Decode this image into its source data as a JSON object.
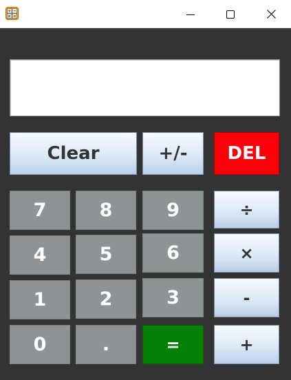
{
  "window": {
    "title_icon": "calculator-app-icon",
    "controls": {
      "minimize_icon": "minimize-icon",
      "maximize_icon": "maximize-icon",
      "close_icon": "close-icon"
    }
  },
  "display": {
    "value": ""
  },
  "top_row": {
    "clear": "Clear",
    "sign": "+/-",
    "del": "DEL"
  },
  "digits": {
    "seven": "7",
    "eight": "8",
    "nine": "9",
    "four": "4",
    "five": "5",
    "six": "6",
    "one": "1",
    "two": "2",
    "three": "3",
    "zero": "0",
    "dot": "."
  },
  "equals": "=",
  "operators": {
    "divide": "÷",
    "multiply": "×",
    "subtract": "-",
    "add": "+"
  },
  "colors": {
    "background": "#333333",
    "digit_key": "#8e9496",
    "del_key": "#fb0006",
    "equals_key": "#048104",
    "light_key_top": "#f7fbff",
    "light_key_bottom": "#b9cfe8"
  }
}
